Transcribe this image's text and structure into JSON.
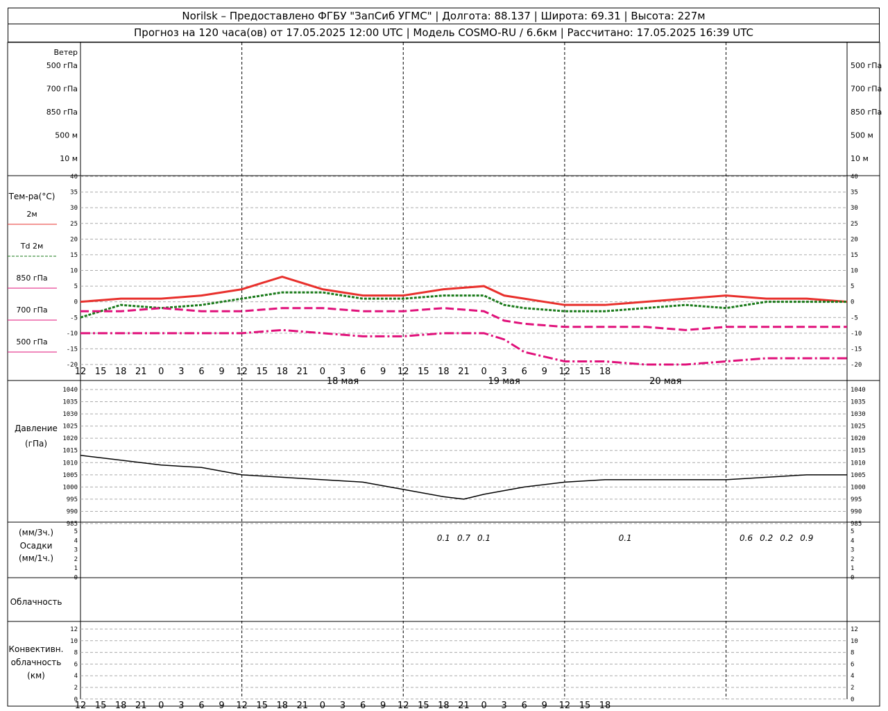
{
  "header": {
    "line1": "Norilsk – Предоставлено ФГБУ \"ЗапСиб УГМС\" | Долгота: 88.137 | Широта: 69.31 | Высота: 227м",
    "line2": "Прогноз на 120 часа(ов) от 17.05.2025 12:00 UTC  | Модель COSMO-RU / 6.6км | Рассчитано: 17.05.2025 16:39 UTC"
  },
  "wind_panel": {
    "title": "Ветер",
    "levels": [
      "500 гПа",
      "700 гПа",
      "850 гПа",
      "500 м",
      "10 м"
    ]
  },
  "temp_panel": {
    "title": "Тем-ра(°C)",
    "legend": [
      "2м",
      "Td 2м",
      "850 гПа",
      "700 гПа",
      "500 гПа"
    ],
    "yticks": [
      40,
      35,
      30,
      25,
      20,
      15,
      10,
      5,
      0,
      -5,
      -10,
      -15,
      -20
    ]
  },
  "pressure_panel": {
    "title": "Давление",
    "unit": "(гПа)",
    "yticks": [
      1040,
      1035,
      1030,
      1025,
      1020,
      1015,
      1010,
      1005,
      1000,
      995,
      990,
      985
    ]
  },
  "precip_panel": {
    "line1": "(мм/3ч.)",
    "line2": "Осадки",
    "line3": "(мм/1ч.)",
    "yticks": [
      5,
      4,
      3,
      2,
      1,
      0
    ],
    "labels": [
      {
        "h": 54,
        "v": "0.1"
      },
      {
        "h": 57,
        "v": "0.7"
      },
      {
        "h": 60,
        "v": "0.1"
      },
      {
        "h": 81,
        "v": "0.1"
      },
      {
        "h": 99,
        "v": "0.6"
      },
      {
        "h": 102,
        "v": "0.2"
      },
      {
        "h": 105,
        "v": "0.2"
      },
      {
        "h": 108,
        "v": "0.9"
      }
    ]
  },
  "cloud_panel": {
    "title": "Облачность"
  },
  "conv_panel": {
    "line1": "Конвективн.",
    "line2": "облачность",
    "line3": "(км)",
    "yticks": [
      12,
      10,
      8,
      6,
      4,
      2,
      0
    ]
  },
  "xaxis": {
    "hours": [
      "12",
      "15",
      "18",
      "21",
      "0",
      "3",
      "6",
      "9",
      "12",
      "15",
      "18",
      "21",
      "0",
      "3",
      "6",
      "9",
      "12",
      "15",
      "18",
      "21",
      "0",
      "3",
      "6",
      "9",
      "12",
      "15",
      "18"
    ],
    "dates": [
      "18 мая",
      "19 мая",
      "20 мая"
    ]
  },
  "chart_data": [
    {
      "type": "line",
      "title": "Тем-ра(°C)",
      "ylim": [
        -20,
        40
      ],
      "x_hours": [
        0,
        6,
        12,
        18,
        24,
        30,
        36,
        42,
        48,
        54,
        60,
        63,
        66,
        72,
        78,
        84,
        90,
        96,
        102,
        108,
        114
      ],
      "series": [
        {
          "name": "2м",
          "color": "#e8302c",
          "values": [
            0,
            1,
            1,
            2,
            4,
            8,
            4,
            2,
            2,
            4,
            5,
            2,
            1,
            -1,
            -1,
            0,
            1,
            2,
            1,
            1,
            0
          ]
        },
        {
          "name": "Td 2м",
          "color": "#1a7a1a",
          "values": [
            -5,
            -1,
            -2,
            -1,
            1,
            3,
            3,
            1,
            1,
            2,
            2,
            -1,
            -2,
            -3,
            -3,
            -2,
            -1,
            -2,
            0,
            0,
            0
          ]
        },
        {
          "name": "850 гПа",
          "color": "#e0107a",
          "values": [
            -3,
            -3,
            -2,
            -3,
            -3,
            -2,
            -2,
            -3,
            -3,
            -2,
            -3,
            -6,
            -7,
            -8,
            -8,
            -8,
            -9,
            -8,
            -8,
            -8,
            -8
          ]
        },
        {
          "name": "700 гПа",
          "color": "#e0107a",
          "values": [
            -10,
            -10,
            -10,
            -10,
            -10,
            -9,
            -10,
            -11,
            -11,
            -10,
            -10,
            -12,
            -16,
            -19,
            -19,
            -20,
            -20,
            -19,
            -18,
            -18,
            -18
          ]
        }
      ]
    },
    {
      "type": "line",
      "title": "Давление",
      "ylim": [
        985,
        1040
      ],
      "x_hours": [
        0,
        6,
        12,
        18,
        24,
        30,
        36,
        42,
        48,
        54,
        57,
        60,
        66,
        72,
        78,
        84,
        90,
        96,
        102,
        108,
        114
      ],
      "series": [
        {
          "name": "Давление",
          "color": "#000000",
          "values": [
            1013,
            1011,
            1009,
            1008,
            1005,
            1004,
            1003,
            1002,
            999,
            996,
            995,
            997,
            1000,
            1002,
            1003,
            1003,
            1003,
            1003,
            1004,
            1005,
            1005
          ]
        }
      ]
    }
  ]
}
